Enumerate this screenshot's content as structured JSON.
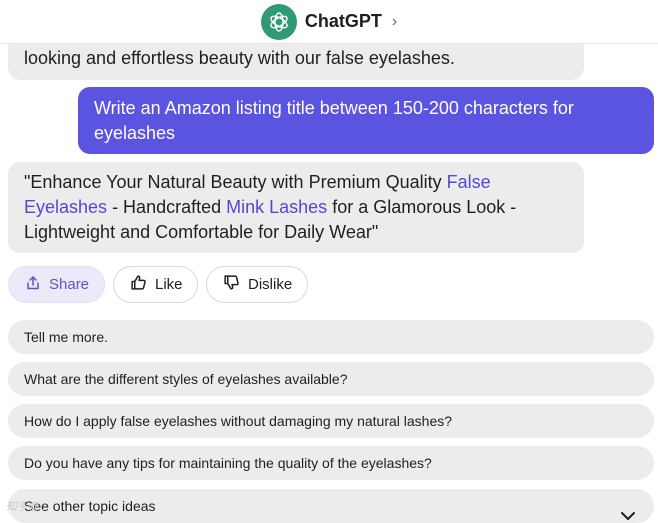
{
  "header": {
    "title": "ChatGPT",
    "chevron": "›"
  },
  "messages": {
    "prev_text": "looking and effortless beauty with our false eyelashes.",
    "user_text": "Write an Amazon listing title between 150-200 characters for eyelashes",
    "bot": {
      "t1": "\"Enhance Your Natural Beauty with Premium Quality ",
      "l1": "False Eyelashes",
      "t2": " - Handcrafted ",
      "l2": "Mink Lashes",
      "t3": " for a Glamorous Look - Lightweight and Comfortable for Daily Wear\""
    }
  },
  "actions": {
    "share": "Share",
    "like": "Like",
    "dislike": "Dislike"
  },
  "suggestions": [
    "Tell me more.",
    "What are the different styles of eyelashes available?",
    "How do I apply false eyelashes without damaging my natural lashes?",
    "Do you have any tips for maintaining the quality of the eyelashes?",
    "See other topic ideas"
  ],
  "watermark": "知乎@...",
  "colors": {
    "brand": "#2f9a74",
    "user_bubble": "#5b54e0",
    "link": "#5149d6"
  },
  "icons": {
    "logo": "openai-logo-icon",
    "share": "share-icon",
    "like": "thumbs-up-icon",
    "dislike": "thumbs-down-icon",
    "more": "chevron-down-icon"
  }
}
